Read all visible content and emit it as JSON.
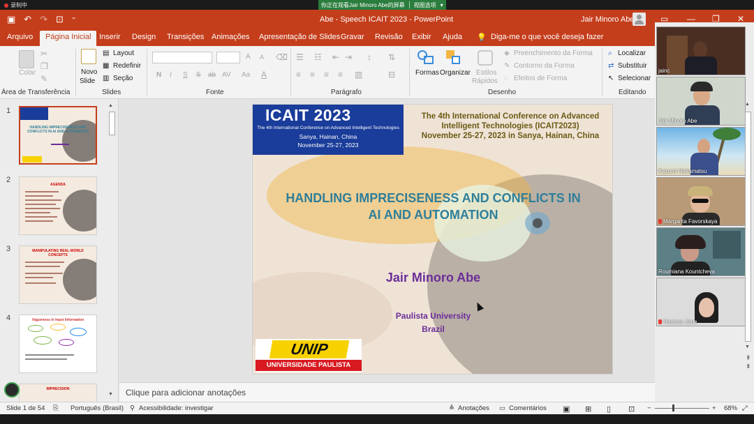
{
  "share_bar": {
    "recording": "录制中",
    "viewing": "你正在观看Jair Minoro Abe的屏幕",
    "options": "视图选项"
  },
  "title_bar": {
    "title": "Abe - Speech ICAIT 2023  -  PowerPoint",
    "user": "Jair Minoro Abe"
  },
  "menu": {
    "tabs": [
      "Arquivo",
      "Página Inicial",
      "Inserir",
      "Design",
      "Transições",
      "Animações",
      "Apresentação de Slides",
      "Gravar",
      "Revisão",
      "Exibir",
      "Ajuda"
    ],
    "active_index": 1,
    "tell_me": "Diga-me o que você deseja fazer"
  },
  "ribbon": {
    "clipboard": {
      "paste": "Colar",
      "label": "Área de Transferência"
    },
    "slides": {
      "new_slide": "Novo",
      "new_slide2": "Slide",
      "layout": "Layout",
      "reset": "Redefinir",
      "section": "Seção",
      "label": "Slides"
    },
    "font": {
      "label": "Fonte",
      "bold": "N",
      "italic": "I",
      "underline": "S",
      "strike": "S",
      "spacing": "AV",
      "case": "Aa",
      "grow": "A",
      "shrink": "A"
    },
    "paragraph": {
      "label": "Parágrafo"
    },
    "drawing": {
      "shapes": "Formas",
      "arrange": "Organizar",
      "styles": "Estilos",
      "styles2": "Rápidos",
      "fill": "Preenchimento da Forma",
      "outline": "Contorno da Forma",
      "effects": "Efeitos de Forma",
      "label": "Desenho"
    },
    "editing": {
      "find": "Localizar",
      "replace": "Substituir",
      "select": "Selecionar",
      "label": "Editando"
    }
  },
  "thumbnails": [
    {
      "num": "1",
      "title": "HANDLING IMPRECISENESS AND CONFLICTS IN AI AND AUTOMATION"
    },
    {
      "num": "2",
      "title": "AGENDA"
    },
    {
      "num": "3",
      "title": "MANIPULATING REAL-WORLD CONCEPTS"
    },
    {
      "num": "4",
      "title": "Vagueness in Input Information"
    },
    {
      "num": "5",
      "title": "IMPRECISION"
    }
  ],
  "slide": {
    "banner_title": "ICAIT 2023",
    "banner_sub": "The 4th International Conference on Advanced Intelligent Technologies",
    "banner_place": "Sanya, Hainan,  China",
    "banner_date": "November 25-27, 2023",
    "conf_line1": "The 4th International Conference on Advanced",
    "conf_line2": "Intelligent Technologies (ICAIT2023)",
    "conf_line3": "November 25-27, 2023 in Sanya, Hainan, China",
    "title_line1": "HANDLING IMPRECISENESS AND CONFLICTS IN",
    "title_line2": "AI AND AUTOMATION",
    "author": "Jair Minoro Abe",
    "affil1": "Paulista University",
    "affil2": "Brazil",
    "logo": "UNIP",
    "logo_bar": "UNIVERSIDADE PAULISTA"
  },
  "notes_placeholder": "Clique para adicionar anotações",
  "status": {
    "slide": "Slide 1 de 54",
    "language": "Português (Brasil)",
    "accessibility": "Acessibilidade: investigar",
    "notes": "Anotações",
    "comments": "Comentários",
    "zoom": "68%"
  },
  "participants": [
    {
      "name": "jainc",
      "muted": false
    },
    {
      "name": "Jair Minoro Abe",
      "muted": false
    },
    {
      "name": "Kazumi Nakamatsu",
      "muted": false
    },
    {
      "name": "Margarita Favorskaya",
      "muted": true
    },
    {
      "name": "Roumiana Kountcheva",
      "muted": false
    },
    {
      "name": "Hostess Jane",
      "muted": true
    }
  ],
  "colors": {
    "accent": "#c43e1c",
    "slide_title": "#2f7f9a",
    "author": "#6c2d99"
  }
}
